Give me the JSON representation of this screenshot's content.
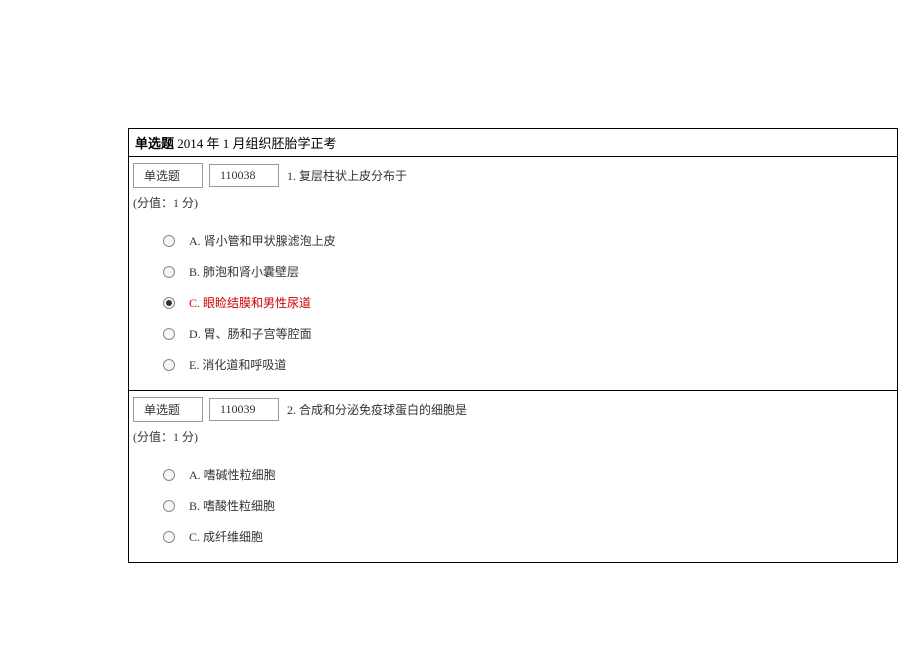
{
  "header": {
    "bold_prefix": "单选题",
    "rest": " 2014 年 1 月组织胚胎学正考"
  },
  "questions": [
    {
      "type_label": "单选题",
      "code": "110038",
      "stem": "1. 复层柱状上皮分布于",
      "score_line": "(分值：1 分)",
      "selected_index": 2,
      "options": [
        {
          "text": "A. 肾小管和甲状腺滤泡上皮",
          "highlight": false
        },
        {
          "text": "B. 肺泡和肾小囊壁层",
          "highlight": false
        },
        {
          "text": "C. 眼睑结膜和男性尿道",
          "highlight": true
        },
        {
          "text": "D. 胃、肠和子宫等腔面",
          "highlight": false
        },
        {
          "text": "E. 消化道和呼吸道",
          "highlight": false
        }
      ]
    },
    {
      "type_label": "单选题",
      "code": "110039",
      "stem": "2. 合成和分泌免疫球蛋白的细胞是",
      "score_line": "(分值：1 分)",
      "selected_index": -1,
      "options": [
        {
          "text": "A. 嗜碱性粒细胞",
          "highlight": false
        },
        {
          "text": "B. 嗜酸性粒细胞",
          "highlight": false
        },
        {
          "text": "C. 成纤维细胞",
          "highlight": false
        }
      ]
    }
  ]
}
